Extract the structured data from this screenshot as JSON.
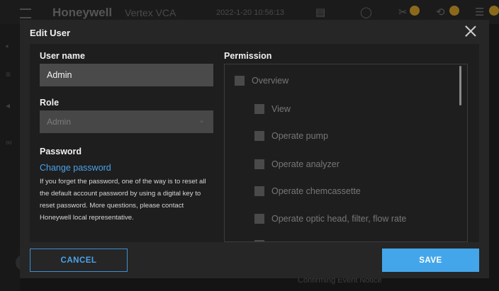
{
  "app": {
    "brand": "Honeywell",
    "product": "Vertex VCA",
    "datetime": "2022-1-20  10:56:13"
  },
  "dialog": {
    "title": "Edit User",
    "username_label": "User name",
    "username_value": "Admin",
    "role_label": "Role",
    "role_value": "Admin",
    "password_label": "Password",
    "change_password_link": "Change password",
    "help_text": "If you forget the password, one of the way is to reset all the default account password by using a digital key to reset password. More questions, please contact Honeywell local representative.",
    "permission_label": "Permission",
    "permissions": [
      {
        "label": "Overview",
        "level": 0
      },
      {
        "label": "View",
        "level": 1
      },
      {
        "label": "Operate pump",
        "level": 1
      },
      {
        "label": "Operate analyzer",
        "level": 1
      },
      {
        "label": "Operate chemcassette",
        "level": 1
      },
      {
        "label": "Operate optic head, filter, flow rate",
        "level": 1
      }
    ],
    "cancel_label": "CANCEL",
    "save_label": "SAVE"
  },
  "background": {
    "status_text": "Confirming Event Notice"
  },
  "colors": {
    "accent": "#44a6ea",
    "dialog_bg": "#262626",
    "panel_bg": "#1e1e1e",
    "input_bg": "#4a4a4a"
  }
}
